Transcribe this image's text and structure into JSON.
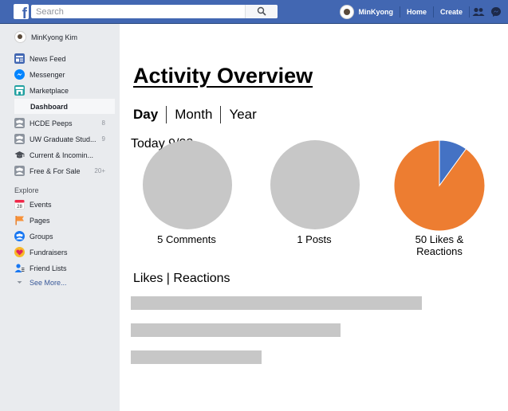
{
  "topbar": {
    "logo": "f",
    "search_placeholder": "Search",
    "user_name": "MinKyong",
    "home_label": "Home",
    "create_label": "Create",
    "brand_color": "#4267b2"
  },
  "sidebar": {
    "profile_name": "MinKyong Kim",
    "items": [
      {
        "label": "News Feed",
        "icon": "news-feed-icon"
      },
      {
        "label": "Messenger",
        "icon": "messenger-icon"
      },
      {
        "label": "Marketplace",
        "icon": "marketplace-icon"
      }
    ],
    "dashboard_label": "Dashboard",
    "groups": [
      {
        "label": "HCDE Peeps",
        "count": "8"
      },
      {
        "label": "UW Graduate Stud...",
        "count": "9"
      },
      {
        "label": "Current & Incomin...",
        "count": ""
      },
      {
        "label": "Free & For Sale",
        "count": "20+"
      }
    ],
    "explore_heading": "Explore",
    "explore_items": [
      {
        "label": "Events",
        "icon": "calendar-icon"
      },
      {
        "label": "Pages",
        "icon": "flag-icon"
      },
      {
        "label": "Groups",
        "icon": "groups-icon"
      },
      {
        "label": "Fundraisers",
        "icon": "heart-icon"
      },
      {
        "label": "Friend Lists",
        "icon": "friend-list-icon"
      }
    ],
    "see_more": "See More..."
  },
  "main": {
    "title": "Activity Overview",
    "ranges": [
      "Day",
      "Month",
      "Year"
    ],
    "active_range": "Day",
    "date_label": "Today 9/28",
    "stats": [
      {
        "label": "5 Comments"
      },
      {
        "label": "1 Posts"
      },
      {
        "label_line1": "50 Likes &",
        "label_line2": "Reactions"
      }
    ],
    "pie": {
      "slices": [
        {
          "label": "Reactions",
          "value": 10,
          "color": "#4472c4"
        },
        {
          "label": "Likes",
          "value": 90,
          "color": "#ed7d31"
        }
      ]
    },
    "section_title": "Likes | Reactions",
    "bars": [
      {
        "fraction": 1.0
      },
      {
        "fraction": 0.72
      },
      {
        "fraction": 0.45
      }
    ]
  }
}
